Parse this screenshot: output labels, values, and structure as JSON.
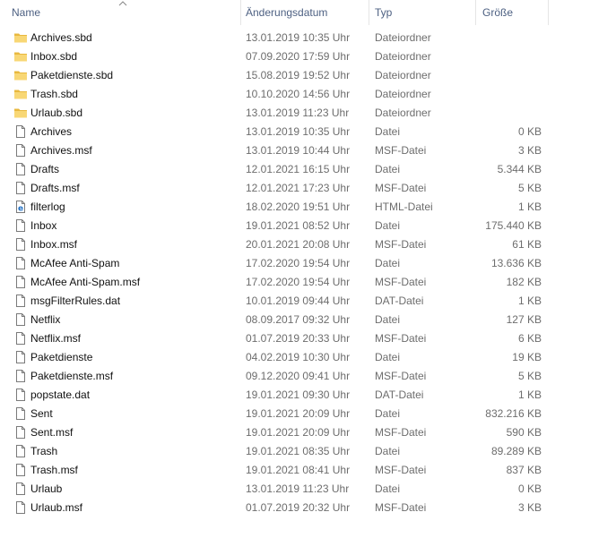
{
  "columns": {
    "name": "Name",
    "date": "Änderungsdatum",
    "type": "Typ",
    "size": "Größe"
  },
  "sort": {
    "column": "name",
    "direction": "ascending",
    "arrow": "chevron-up-icon"
  },
  "colors": {
    "folder": "#f8d775",
    "folder_dark": "#e8b83f",
    "header_text": "#4d6082",
    "meta_text": "#6d6d6d",
    "html_icon": "#1f6fc5"
  },
  "files": [
    {
      "name": "Archives.sbd",
      "date": "13.01.2019 10:35 Uhr",
      "type": "Dateiordner",
      "size": "",
      "icon": "folder-icon"
    },
    {
      "name": "Inbox.sbd",
      "date": "07.09.2020 17:59 Uhr",
      "type": "Dateiordner",
      "size": "",
      "icon": "folder-icon"
    },
    {
      "name": "Paketdienste.sbd",
      "date": "15.08.2019 19:52 Uhr",
      "type": "Dateiordner",
      "size": "",
      "icon": "folder-icon"
    },
    {
      "name": "Trash.sbd",
      "date": "10.10.2020 14:56 Uhr",
      "type": "Dateiordner",
      "size": "",
      "icon": "folder-icon"
    },
    {
      "name": "Urlaub.sbd",
      "date": "13.01.2019 11:23 Uhr",
      "type": "Dateiordner",
      "size": "",
      "icon": "folder-icon"
    },
    {
      "name": "Archives",
      "date": "13.01.2019 10:35 Uhr",
      "type": "Datei",
      "size": "0 KB",
      "icon": "file-icon"
    },
    {
      "name": "Archives.msf",
      "date": "13.01.2019 10:44 Uhr",
      "type": "MSF-Datei",
      "size": "3 KB",
      "icon": "file-icon"
    },
    {
      "name": "Drafts",
      "date": "12.01.2021 16:15 Uhr",
      "type": "Datei",
      "size": "5.344 KB",
      "icon": "file-icon"
    },
    {
      "name": "Drafts.msf",
      "date": "12.01.2021 17:23 Uhr",
      "type": "MSF-Datei",
      "size": "5 KB",
      "icon": "file-icon"
    },
    {
      "name": "filterlog",
      "date": "18.02.2020 19:51 Uhr",
      "type": "HTML-Datei",
      "size": "1 KB",
      "icon": "html-file-icon"
    },
    {
      "name": "Inbox",
      "date": "19.01.2021 08:52 Uhr",
      "type": "Datei",
      "size": "175.440 KB",
      "icon": "file-icon"
    },
    {
      "name": "Inbox.msf",
      "date": "20.01.2021 20:08 Uhr",
      "type": "MSF-Datei",
      "size": "61 KB",
      "icon": "file-icon"
    },
    {
      "name": "McAfee Anti-Spam",
      "date": "17.02.2020 19:54 Uhr",
      "type": "Datei",
      "size": "13.636 KB",
      "icon": "file-icon"
    },
    {
      "name": "McAfee Anti-Spam.msf",
      "date": "17.02.2020 19:54 Uhr",
      "type": "MSF-Datei",
      "size": "182 KB",
      "icon": "file-icon"
    },
    {
      "name": "msgFilterRules.dat",
      "date": "10.01.2019 09:44 Uhr",
      "type": "DAT-Datei",
      "size": "1 KB",
      "icon": "file-icon"
    },
    {
      "name": "Netflix",
      "date": "08.09.2017 09:32 Uhr",
      "type": "Datei",
      "size": "127 KB",
      "icon": "file-icon"
    },
    {
      "name": "Netflix.msf",
      "date": "01.07.2019 20:33 Uhr",
      "type": "MSF-Datei",
      "size": "6 KB",
      "icon": "file-icon"
    },
    {
      "name": "Paketdienste",
      "date": "04.02.2019 10:30 Uhr",
      "type": "Datei",
      "size": "19 KB",
      "icon": "file-icon"
    },
    {
      "name": "Paketdienste.msf",
      "date": "09.12.2020 09:41 Uhr",
      "type": "MSF-Datei",
      "size": "5 KB",
      "icon": "file-icon"
    },
    {
      "name": "popstate.dat",
      "date": "19.01.2021 09:30 Uhr",
      "type": "DAT-Datei",
      "size": "1 KB",
      "icon": "file-icon"
    },
    {
      "name": "Sent",
      "date": "19.01.2021 20:09 Uhr",
      "type": "Datei",
      "size": "832.216 KB",
      "icon": "file-icon"
    },
    {
      "name": "Sent.msf",
      "date": "19.01.2021 20:09 Uhr",
      "type": "MSF-Datei",
      "size": "590 KB",
      "icon": "file-icon"
    },
    {
      "name": "Trash",
      "date": "19.01.2021 08:35 Uhr",
      "type": "Datei",
      "size": "89.289 KB",
      "icon": "file-icon"
    },
    {
      "name": "Trash.msf",
      "date": "19.01.2021 08:41 Uhr",
      "type": "MSF-Datei",
      "size": "837 KB",
      "icon": "file-icon"
    },
    {
      "name": "Urlaub",
      "date": "13.01.2019 11:23 Uhr",
      "type": "Datei",
      "size": "0 KB",
      "icon": "file-icon"
    },
    {
      "name": "Urlaub.msf",
      "date": "01.07.2019 20:32 Uhr",
      "type": "MSF-Datei",
      "size": "3 KB",
      "icon": "file-icon"
    }
  ]
}
